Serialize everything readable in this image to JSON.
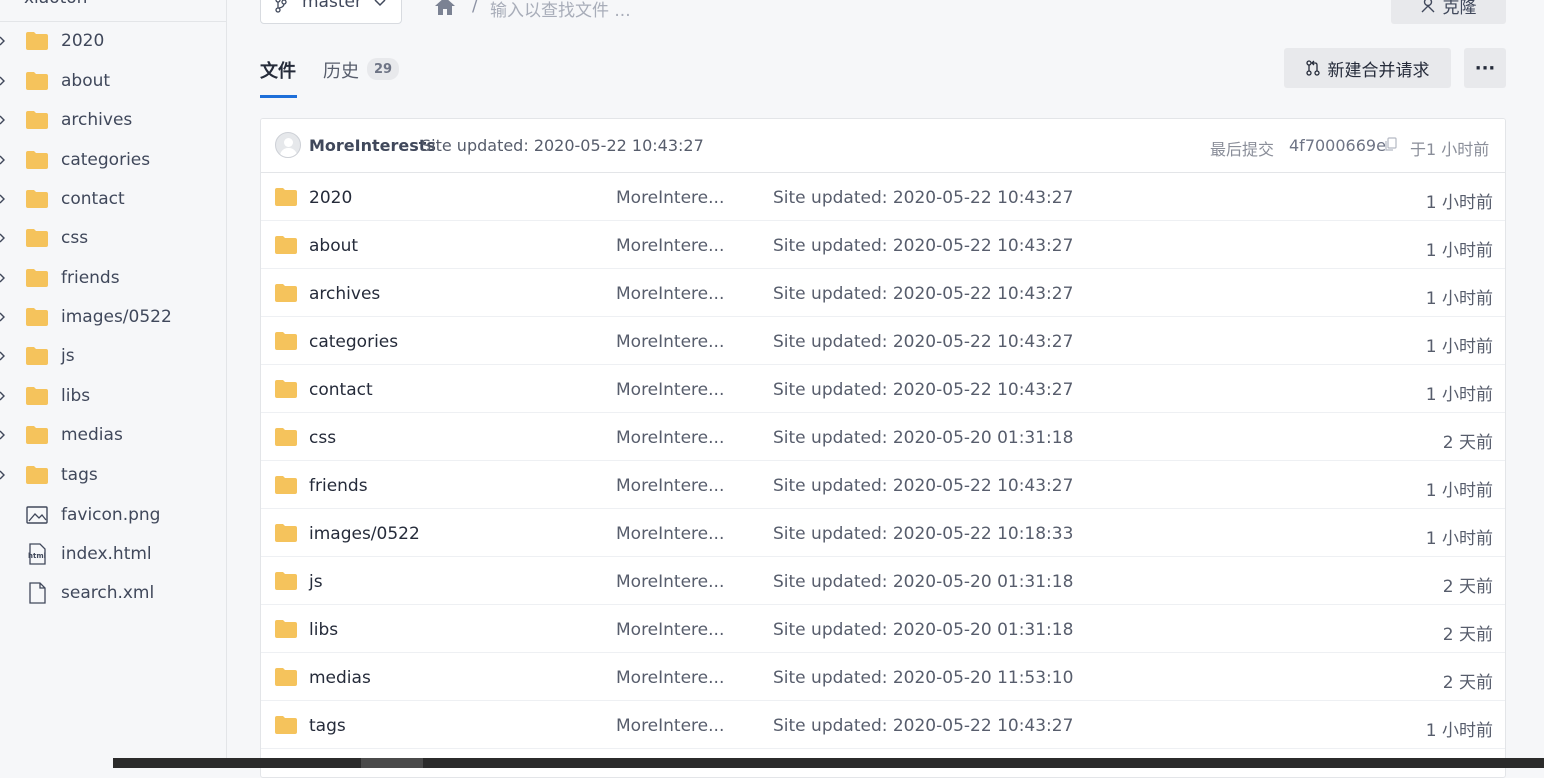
{
  "sidebar": {
    "repo_name": "xiaoton",
    "items": [
      {
        "label": "2020",
        "type": "folder"
      },
      {
        "label": "about",
        "type": "folder"
      },
      {
        "label": "archives",
        "type": "folder"
      },
      {
        "label": "categories",
        "type": "folder"
      },
      {
        "label": "contact",
        "type": "folder"
      },
      {
        "label": "css",
        "type": "folder"
      },
      {
        "label": "friends",
        "type": "folder"
      },
      {
        "label": "images/0522",
        "type": "folder"
      },
      {
        "label": "js",
        "type": "folder"
      },
      {
        "label": "libs",
        "type": "folder"
      },
      {
        "label": "medias",
        "type": "folder"
      },
      {
        "label": "tags",
        "type": "folder"
      },
      {
        "label": "favicon.png",
        "type": "image"
      },
      {
        "label": "index.html",
        "type": "html"
      },
      {
        "label": "search.xml",
        "type": "file"
      }
    ]
  },
  "toolbar": {
    "branch": "master",
    "breadcrumb_sep": "/",
    "search_placeholder": "输入以查找文件 ...",
    "clone_label": "克隆"
  },
  "tabs": {
    "files_label": "文件",
    "history_label": "历史",
    "history_count": "29"
  },
  "actions": {
    "merge_request_label": "新建合并请求",
    "more_label": "···"
  },
  "commit": {
    "author": "MoreInterests",
    "message": "Site updated: 2020-05-22 10:43:27",
    "last_commit_label": "最后提交",
    "hash": "4f7000669e",
    "time": "于1 小时前"
  },
  "files": [
    {
      "name": "2020",
      "author": "MoreIntere...",
      "message": "Site updated: 2020-05-22 10:43:27",
      "time": "1 小时前"
    },
    {
      "name": "about",
      "author": "MoreIntere...",
      "message": "Site updated: 2020-05-22 10:43:27",
      "time": "1 小时前"
    },
    {
      "name": "archives",
      "author": "MoreIntere...",
      "message": "Site updated: 2020-05-22 10:43:27",
      "time": "1 小时前"
    },
    {
      "name": "categories",
      "author": "MoreIntere...",
      "message": "Site updated: 2020-05-22 10:43:27",
      "time": "1 小时前"
    },
    {
      "name": "contact",
      "author": "MoreIntere...",
      "message": "Site updated: 2020-05-22 10:43:27",
      "time": "1 小时前"
    },
    {
      "name": "css",
      "author": "MoreIntere...",
      "message": "Site updated: 2020-05-20 01:31:18",
      "time": "2 天前"
    },
    {
      "name": "friends",
      "author": "MoreIntere...",
      "message": "Site updated: 2020-05-22 10:43:27",
      "time": "1 小时前"
    },
    {
      "name": "images/0522",
      "author": "MoreIntere...",
      "message": "Site updated: 2020-05-22 10:18:33",
      "time": "1 小时前"
    },
    {
      "name": "js",
      "author": "MoreIntere...",
      "message": "Site updated: 2020-05-20 01:31:18",
      "time": "2 天前"
    },
    {
      "name": "libs",
      "author": "MoreIntere...",
      "message": "Site updated: 2020-05-20 01:31:18",
      "time": "2 天前"
    },
    {
      "name": "medias",
      "author": "MoreIntere...",
      "message": "Site updated: 2020-05-20 11:53:10",
      "time": "2 天前"
    },
    {
      "name": "tags",
      "author": "MoreIntere...",
      "message": "Site updated: 2020-05-22 10:43:27",
      "time": "1 小时前"
    }
  ],
  "colors": {
    "folder": "#f5c35c",
    "accent": "#1e6fd9"
  }
}
